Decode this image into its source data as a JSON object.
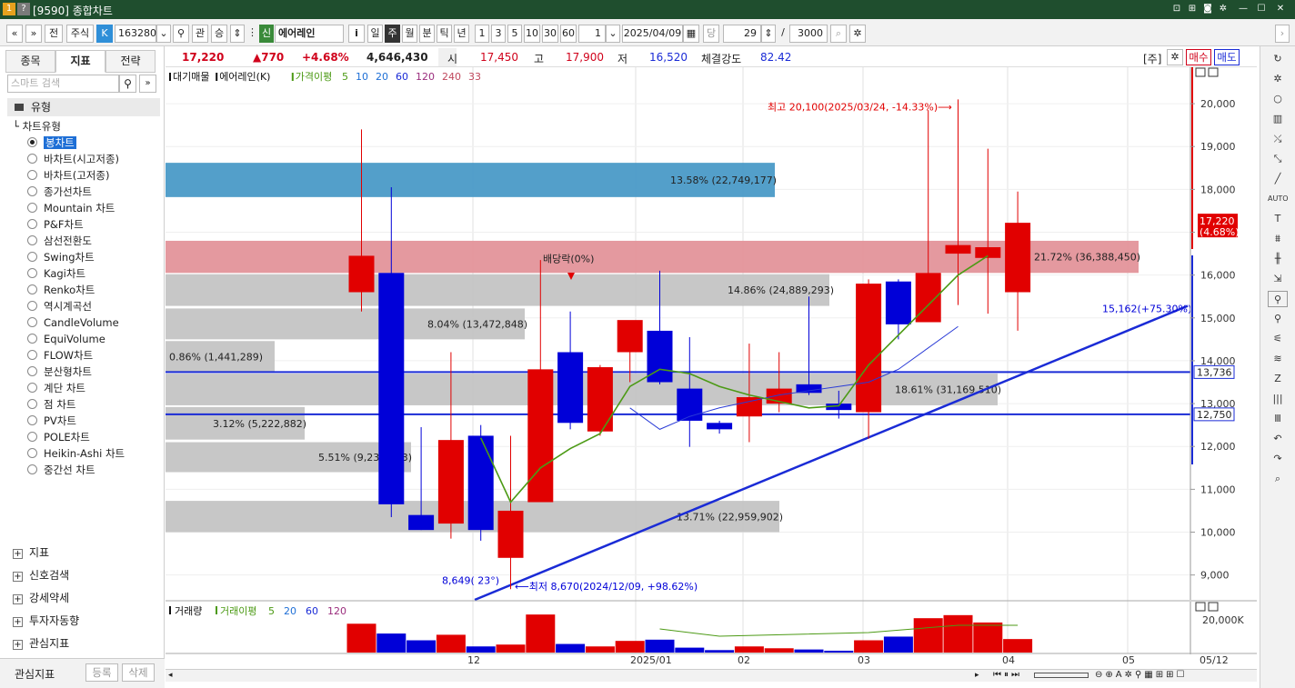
{
  "window": {
    "title": "[9590] 종합차트"
  },
  "toolbar": {
    "market": "주식",
    "code": "163280",
    "tag_k": "K",
    "btn_gwan": "관",
    "btn_seung": "승",
    "badge_sin": "신",
    "stock_name": "에어레인",
    "btn_i": "i",
    "periods": [
      "일",
      "주",
      "월",
      "분",
      "틱",
      "년"
    ],
    "active_period": "주",
    "intervals": [
      "1",
      "3",
      "5",
      "10",
      "30",
      "60"
    ],
    "count_value": "1",
    "date": "2025/04/09",
    "label_dang": "당",
    "view_count": "29",
    "slash": "/",
    "total_count": "3000"
  },
  "left": {
    "tabs": [
      "종목",
      "지표",
      "전략"
    ],
    "active_tab": "지표",
    "search_placeholder": "스마트 검색",
    "section_type": "유형",
    "group_label": "차트유형",
    "chart_types": [
      "봉차트",
      "바차트(시고저종)",
      "바차트(고저종)",
      "종가선차트",
      "Mountain 차트",
      "P&F차트",
      "삼선전환도",
      "Swing차트",
      "Kagi차트",
      "Renko차트",
      "역시계곡선",
      "CandleVolume",
      "EquiVolume",
      "FLOW차트",
      "분산형차트",
      "계단 차트",
      "점 차트",
      "PV차트",
      "POLE차트",
      "Heikin-Ashi 차트",
      "중간선 차트"
    ],
    "selected_type": "봉차트",
    "sections": [
      "지표",
      "신호검색",
      "강세약세",
      "투자자동향",
      "관심지표"
    ],
    "bottom_label": "관심지표",
    "btn_register": "등록",
    "btn_delete": "삭제"
  },
  "info": {
    "price": "17,220",
    "change": "▲770",
    "change_pct": "+4.68%",
    "volume": "4,646,430",
    "open_label": "시",
    "open": "17,450",
    "high_label": "고",
    "high": "17,900",
    "low_label": "저",
    "low": "16,520",
    "strength_label": "체결강도",
    "strength": "82.42",
    "ju_label": "[주]",
    "buy_label": "매수",
    "sell_label": "매도"
  },
  "legend": {
    "items": [
      "대기매물",
      "에어레인(K)",
      "가격이평",
      "5",
      "10",
      "20",
      "60",
      "120",
      "240",
      "33"
    ]
  },
  "chart_data": {
    "type": "candlestick",
    "x_ticks": [
      "12",
      "2025/01",
      "02",
      "03",
      "04",
      "05"
    ],
    "last_date_label": "05/12",
    "y_ticks": [
      9000,
      10000,
      11000,
      12000,
      13000,
      14000,
      15000,
      16000,
      17000,
      18000,
      19000,
      20000
    ],
    "y_tick_labels": [
      "9,000",
      "10,000",
      "11,000",
      "12,000",
      "13,000",
      "14,000",
      "15,000",
      "16,000",
      "17,000",
      "18,000",
      "19,000",
      "20,000"
    ],
    "ylim": [
      8420,
      20850
    ],
    "current_price_label": "17,220",
    "current_pct_label": "(4.68%)",
    "hline_labels": [
      "13,736",
      "12,750"
    ],
    "hlines": [
      13736,
      12750
    ],
    "candles": [
      {
        "o": 15600,
        "h": 19400,
        "l": 15150,
        "c": 16450
      },
      {
        "o": 16050,
        "h": 18050,
        "l": 10350,
        "c": 10650
      },
      {
        "o": 10400,
        "h": 12450,
        "l": 10050,
        "c": 10050
      },
      {
        "o": 10200,
        "h": 14200,
        "l": 9850,
        "c": 12150
      },
      {
        "o": 12250,
        "h": 12500,
        "l": 9800,
        "c": 10050
      },
      {
        "o": 9400,
        "h": 12250,
        "l": 8670,
        "c": 10500
      },
      {
        "o": 10700,
        "h": 16350,
        "l": 10700,
        "c": 13800
      },
      {
        "o": 14200,
        "h": 15150,
        "l": 12400,
        "c": 12550
      },
      {
        "o": 12350,
        "h": 13900,
        "l": 12250,
        "c": 13850
      },
      {
        "o": 14200,
        "h": 14900,
        "l": 13500,
        "c": 14950
      },
      {
        "o": 14700,
        "h": 16100,
        "l": 13450,
        "c": 13500
      },
      {
        "o": 13350,
        "h": 14550,
        "l": 11990,
        "c": 12600
      },
      {
        "o": 12550,
        "h": 12600,
        "l": 12300,
        "c": 12400
      },
      {
        "o": 12700,
        "h": 14400,
        "l": 12100,
        "c": 13150
      },
      {
        "o": 13000,
        "h": 14200,
        "l": 12800,
        "c": 13350
      },
      {
        "o": 13450,
        "h": 15500,
        "l": 13200,
        "c": 13250
      },
      {
        "o": 13000,
        "h": 13300,
        "l": 12650,
        "c": 12850
      },
      {
        "o": 12800,
        "h": 15900,
        "l": 12180,
        "c": 15800
      },
      {
        "o": 15850,
        "h": 15900,
        "l": 14500,
        "c": 14850
      },
      {
        "o": 14900,
        "h": 19850,
        "l": 14900,
        "c": 16050
      },
      {
        "o": 16500,
        "h": 20100,
        "l": 15300,
        "c": 16700
      },
      {
        "o": 16400,
        "h": 18950,
        "l": 15100,
        "c": 16650
      },
      {
        "o": 15600,
        "h": 17950,
        "l": 14700,
        "c": 17220
      }
    ],
    "ma5": [
      null,
      null,
      null,
      null,
      12200,
      10700,
      11500,
      11950,
      12300,
      13400,
      13800,
      13700,
      13400,
      13200,
      13050,
      12900,
      12950,
      13900,
      14600,
      15300,
      16000,
      16450
    ],
    "ma10": [
      null,
      null,
      null,
      null,
      null,
      null,
      null,
      null,
      null,
      12900,
      12400,
      12700,
      12900,
      13050,
      13200,
      13300,
      13400,
      13500,
      13800,
      14300,
      14800
    ],
    "volume": {
      "label": "거래량",
      "ma_label": "거래이평",
      "ma_params": [
        "5",
        "20",
        "60",
        "120"
      ],
      "max_label": "20,000K",
      "bars": [
        4700,
        3100,
        2000,
        2900,
        1000,
        1300,
        6200,
        1400,
        1000,
        1900,
        2100,
        800,
        400,
        1000,
        700,
        500,
        300,
        2000,
        2600,
        5600,
        6100,
        4900,
        2200
      ]
    },
    "zones": [
      {
        "label": "13.58% (22,749,177)",
        "color": "#4a9ac7"
      },
      {
        "label": "21.72% (36,388,450)",
        "color": "#e3939a"
      },
      {
        "label": "14.86% (24,889,293)",
        "color": "#c4c4c4"
      },
      {
        "label": "8.04% (13,472,848)",
        "color": "#c4c4c4"
      },
      {
        "label": "0.86% (1,441,289)",
        "color": "#c4c4c4"
      },
      {
        "label": "18.61% (31,169,510)",
        "color": "#c4c4c4"
      },
      {
        "label": "3.12% (5,222,882)",
        "color": "#c4c4c4"
      },
      {
        "label": "5.51% (9,230,693)",
        "color": "#c4c4c4"
      },
      {
        "label": "13.71% (22,959,902)",
        "color": "#c4c4c4"
      }
    ],
    "annotations": {
      "high": "최고 20,100(2025/03/24, -14.33%)⟶",
      "low": "⟵최저 8,670(2024/12/09, +98.62%)",
      "dividend": "배당락(0%)",
      "trend_start": "8,649( 23°)",
      "trend_end": "15,162(+75.30%)"
    }
  }
}
